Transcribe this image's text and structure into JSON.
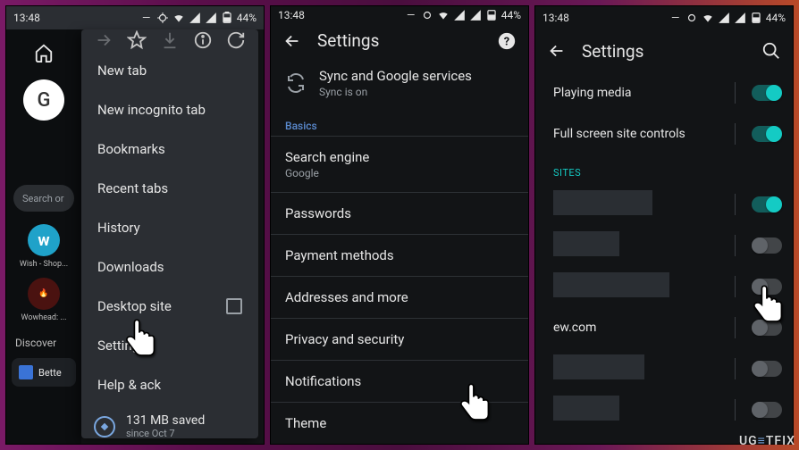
{
  "status": {
    "time": "13:48",
    "battery": "44%"
  },
  "panel1": {
    "left": {
      "search_placeholder": "Search or",
      "app1": "Wish - Shop...",
      "app2": "Wowhead: ...",
      "discover": "Discover",
      "card": "Bette"
    },
    "menu": {
      "new_tab": "New tab",
      "new_incognito": "New incognito tab",
      "bookmarks": "Bookmarks",
      "recent_tabs": "Recent tabs",
      "history": "History",
      "downloads": "Downloads",
      "desktop_site": "Desktop site",
      "settings": "Settings",
      "help": "Help & feedback",
      "help_visible": "Help &           ack",
      "data_main": "131 MB saved",
      "data_sub": "since Oct 7"
    }
  },
  "panel2": {
    "title": "Settings",
    "sync_title": "Sync and Google services",
    "sync_sub": "Sync is on",
    "basics": "Basics",
    "items": [
      {
        "title": "Search engine",
        "sub": "Google"
      },
      {
        "title": "Passwords"
      },
      {
        "title": "Payment methods"
      },
      {
        "title": "Addresses and more"
      },
      {
        "title": "Privacy and security"
      },
      {
        "title": "Notifications"
      },
      {
        "title": "Theme"
      }
    ]
  },
  "panel3": {
    "title": "Settings",
    "rows": [
      {
        "label": "Playing media",
        "on": true,
        "color": "teal"
      },
      {
        "label": "Full screen site controls",
        "on": true,
        "color": "teal"
      }
    ],
    "sites_label": "SITES",
    "site_rows": [
      {
        "label": "",
        "on": true,
        "color": "teal",
        "blocked": true
      },
      {
        "label": "",
        "on": false,
        "blocked": true
      },
      {
        "label": "",
        "on": false,
        "blocked": true
      },
      {
        "label": "ew.com",
        "on": false
      },
      {
        "label": "",
        "on": false,
        "blocked": true
      },
      {
        "label": "",
        "on": false,
        "blocked": true
      }
    ]
  },
  "watermark": "UGETFIX"
}
